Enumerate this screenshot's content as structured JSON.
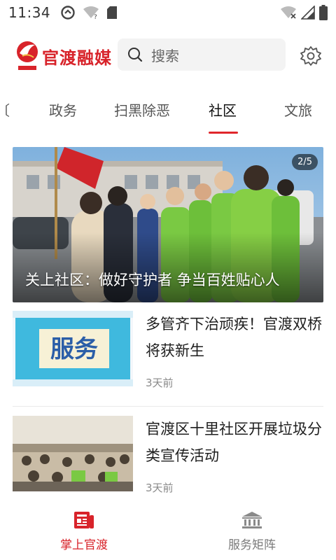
{
  "status_bar": {
    "time": "11:34"
  },
  "header": {
    "logo_text": "官渡融媒",
    "search_placeholder": "搜索"
  },
  "tabs": [
    {
      "label": "政务",
      "active": false
    },
    {
      "label": "扫黑除恶",
      "active": false
    },
    {
      "label": "社区",
      "active": true
    },
    {
      "label": "文旅",
      "active": false
    }
  ],
  "banner": {
    "caption": "关上社区：做好守护者 争当百姓贴心人",
    "counter": "2/5"
  },
  "news": [
    {
      "title": "多管齐下治顽疾！官渡双桥将获新生",
      "time": "3天前",
      "thumb_text": "服务"
    },
    {
      "title": "官渡区十里社区开展垃圾分类宣传活动",
      "time": "3天前"
    }
  ],
  "bottom_nav": [
    {
      "label": "掌上官渡",
      "icon": "news-icon",
      "active": true
    },
    {
      "label": "服务矩阵",
      "icon": "bank-icon",
      "active": false
    }
  ],
  "colors": {
    "brand_red": "#d8232a",
    "tab_indicator": "#e0262b"
  }
}
